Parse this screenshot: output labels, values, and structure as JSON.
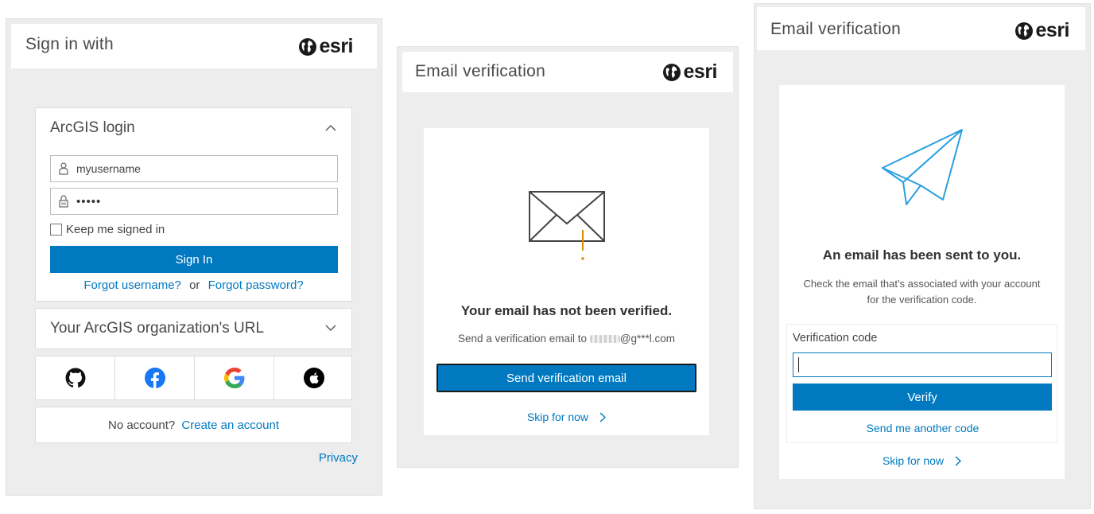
{
  "brand": {
    "logo_text": "esri"
  },
  "signin": {
    "header_title": "Sign in with",
    "arcgis_login_label": "ArcGIS login",
    "username_value": "myusername",
    "password_value": "•••••",
    "keep_signed_in_label": "Keep me signed in",
    "signin_button_label": "Sign In",
    "forgot_username_label": "Forgot username?",
    "or_label": "or",
    "forgot_password_label": "Forgot password?",
    "org_url_label": "Your ArcGIS organization's URL",
    "social_icons": [
      "github-icon",
      "facebook-icon",
      "google-icon",
      "apple-icon"
    ],
    "no_account_label": "No account?",
    "create_account_label": "Create an account",
    "privacy_label": "Privacy"
  },
  "email_unverified": {
    "header_title": "Email verification",
    "heading": "Your email has not been verified.",
    "send_to_label": "Send a verification email to",
    "masked_email_suffix": "@g***l.com",
    "send_button_label": "Send verification email",
    "skip_label": "Skip for now"
  },
  "email_sent": {
    "header_title": "Email verification",
    "heading": "An email has been sent to you.",
    "body_line1": "Check the email that's associated with your account",
    "body_line2": "for the verification code.",
    "code_label": "Verification code",
    "code_value": "",
    "verify_button_label": "Verify",
    "resend_label": "Send me another code",
    "skip_label": "Skip for now"
  },
  "colors": {
    "accent": "#0079c1",
    "warning": "#e08a00",
    "panel_bg": "#ededed"
  }
}
